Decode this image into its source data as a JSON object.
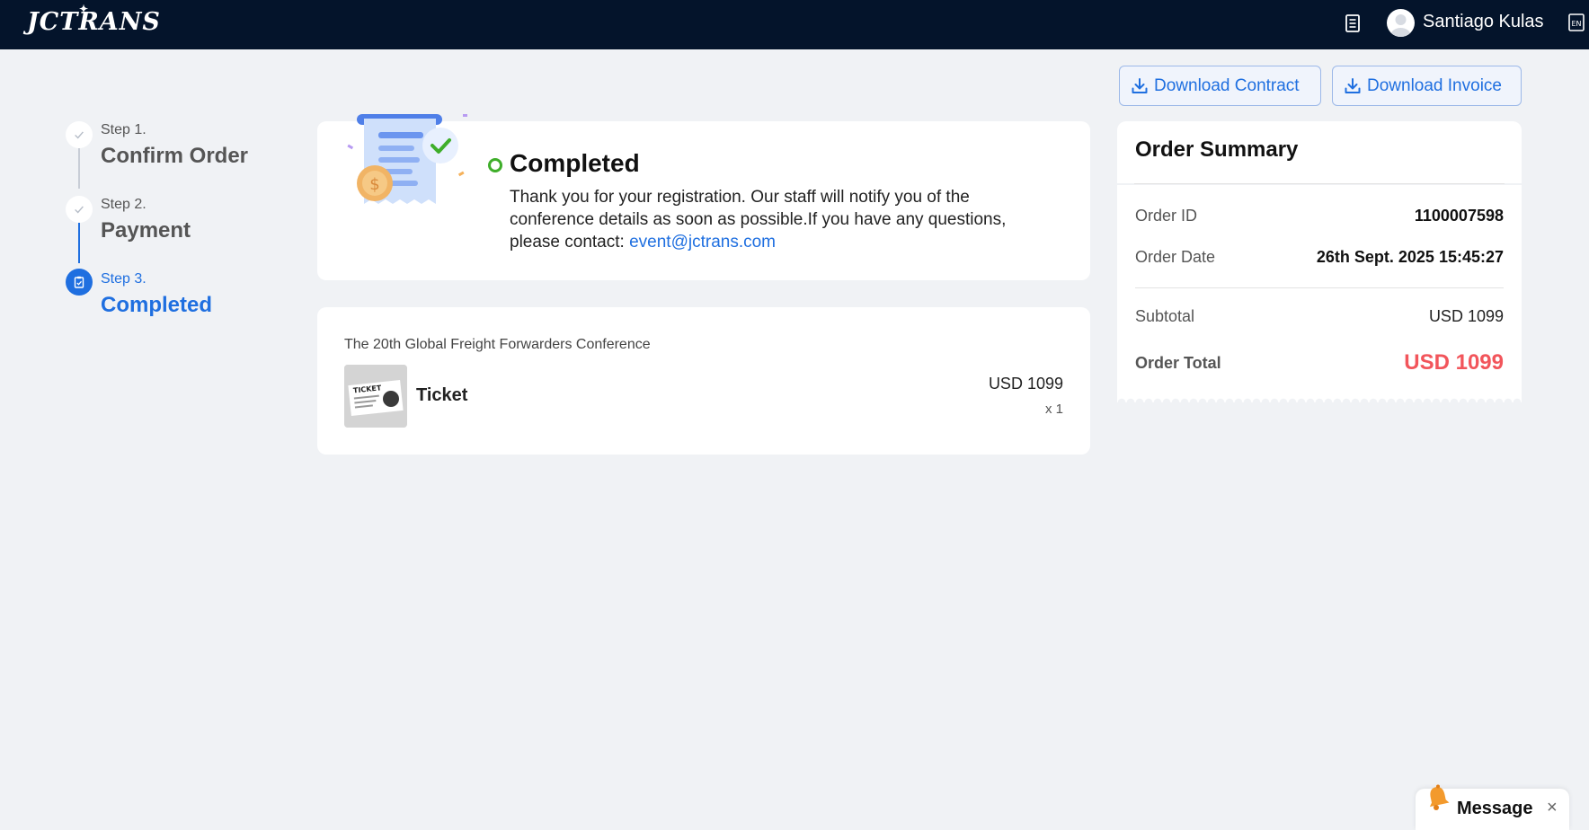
{
  "header": {
    "logo": "JCTRANS",
    "user_name": "Santiago Kulas"
  },
  "actions": {
    "download_contract": "Download Contract",
    "download_invoice": "Download Invoice"
  },
  "steps": [
    {
      "num": "Step 1.",
      "title": "Confirm Order",
      "state": "done"
    },
    {
      "num": "Step 2.",
      "title": "Payment",
      "state": "done"
    },
    {
      "num": "Step 3.",
      "title": "Completed",
      "state": "active"
    }
  ],
  "completion": {
    "title": "Completed",
    "message": "Thank you for your registration. Our staff will notify you of the conference details as soon as possible.If you have any questions, please contact: ",
    "email": "event@jctrans.com"
  },
  "order_item": {
    "conference": "The 20th Global Freight Forwarders Conference",
    "name": "Ticket",
    "thumb_text": "TICKET",
    "price": "USD 1099",
    "qty": "x 1"
  },
  "summary": {
    "title": "Order Summary",
    "order_id_label": "Order ID",
    "order_id": "1100007598",
    "order_date_label": "Order Date",
    "order_date": "26th Sept. 2025 15:45:27",
    "subtotal_label": "Subtotal",
    "subtotal": "USD 1099",
    "total_label": "Order Total",
    "total": "USD 1099"
  },
  "message_widget": {
    "label": "Message",
    "close": "×"
  },
  "colors": {
    "header_bg": "#04142b",
    "accent": "#1f6fe0",
    "success": "#3fae2a",
    "total": "#f2555b",
    "page_bg": "#f0f2f5"
  },
  "icons": [
    "document-icon",
    "avatar-icon",
    "language-icon",
    "download-icon",
    "check-icon",
    "clipboard-check-icon",
    "bell-icon",
    "close-icon"
  ]
}
